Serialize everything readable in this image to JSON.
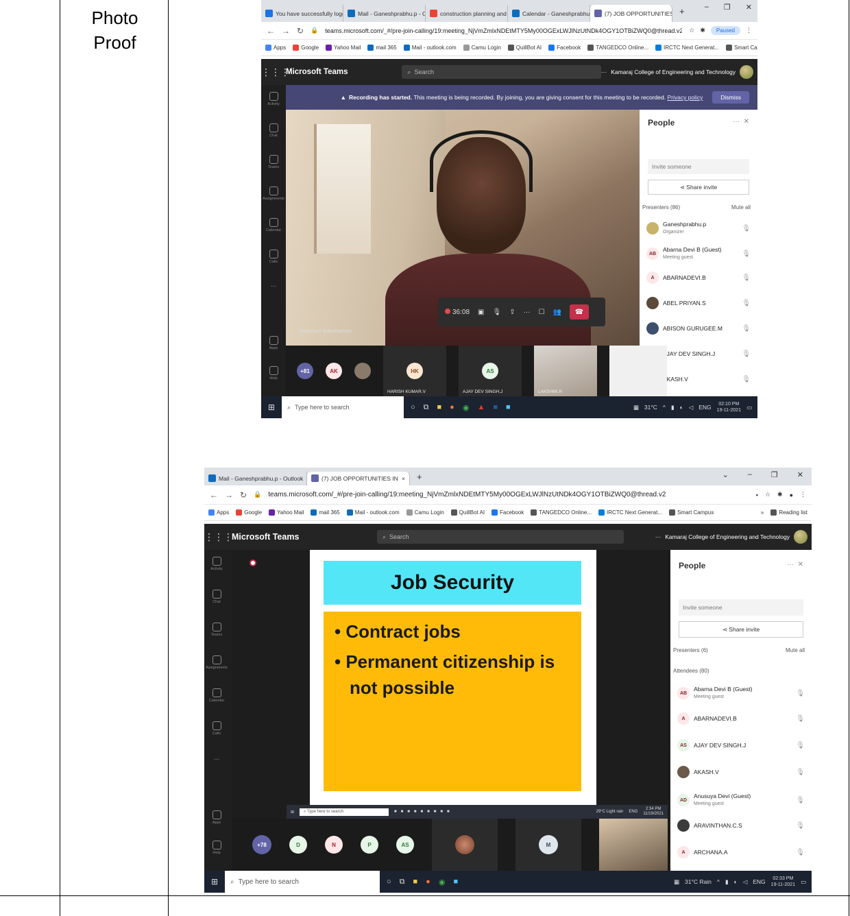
{
  "document": {
    "label_line1": "Photo",
    "label_line2": "Proof"
  },
  "shot1": {
    "tabs": [
      {
        "label": "You have successfully logged",
        "color": "#1a73e8"
      },
      {
        "label": "Mail - Ganeshprabhu.p - Out",
        "color": "#0f6cbd"
      },
      {
        "label": "construction planning and s",
        "color": "#ea4335"
      },
      {
        "label": "Calendar - Ganeshprabhu.p",
        "color": "#0f6cbd"
      },
      {
        "label": "(7) JOB OPPORTUNITIES",
        "color": "#6264a7"
      }
    ],
    "url": "teams.microsoft.com/_#/pre-join-calling/19:meeting_NjVmZmlxNDEtMTY5My00OGExLWJlNzUtNDk4OGY1OTBiZWQ0@thread.v2",
    "paused": "Paused",
    "bookmarks": [
      "Apps",
      "Google",
      "Yahoo Mail",
      "mail 365",
      "Mail - outlook.com",
      "Camu Login",
      "QuillBot AI",
      "Facebook",
      "TANGEDCO Online...",
      "IRCTC Next Generat...",
      "Smart Campus",
      "»",
      "Reading list"
    ],
    "app_title": "Microsoft Teams",
    "search_placeholder": "Search",
    "org": "Kamaraj College of Engineering and Technology",
    "rail": [
      "Activity",
      "Chat",
      "Teams",
      "Assignments",
      "Calendar",
      "Calls",
      "...",
      "Apps",
      "Help"
    ],
    "banner_bold": "Recording has started.",
    "banner_text": "This meeting is being recorded. By joining, you are giving consent for this meeting to be recorded.",
    "banner_link": "Privacy policy",
    "dismiss": "Dismiss",
    "people_title": "People",
    "invite": "Invite someone",
    "share": "Share invite",
    "presenters": "Presenters (86)",
    "mute_all": "Mute all",
    "people": [
      {
        "name": "Ganeshprabhu.p",
        "sub": "Organizer",
        "initials": "",
        "bg": "#c9b36a"
      },
      {
        "name": "Abarna Devi B (Guest)",
        "sub": "Meeting guest",
        "initials": "AB",
        "bg": "#fde7e9"
      },
      {
        "name": "ABARNADEVI.B",
        "sub": "",
        "initials": "A",
        "bg": "#fde7e9"
      },
      {
        "name": "ABEL PRIYAN.S",
        "sub": "",
        "initials": "",
        "bg": "#5b4a3a"
      },
      {
        "name": "ABISON GURUGEE.M",
        "sub": "",
        "initials": "",
        "bg": "#3d4f6b"
      },
      {
        "name": "AJAY DEV SINGH.J",
        "sub": "",
        "initials": "AS",
        "bg": "#e8f5e9"
      },
      {
        "name": "AKASH.V",
        "sub": "",
        "initials": "",
        "bg": "#6b5a4a"
      }
    ],
    "speaker": "Neelamani Subramaniam",
    "timer": "36:08",
    "gallery": {
      "more": "+81",
      "ak": "AK",
      "hk": "HK",
      "hk_name": "HARISH KUMAR.V",
      "as": "AS",
      "as_name": "AJAY DEV SINGH.J",
      "lak_name": "LAKSHMI.R"
    },
    "taskbar_search": "Type here to search",
    "weather": "31°C",
    "lang": "ENG",
    "time": "02:10 PM",
    "date": "19-11-2021"
  },
  "shot2": {
    "tabs": [
      {
        "label": "Mail - Ganeshprabhu.p - Outlook",
        "color": "#0f6cbd"
      },
      {
        "label": "(7) JOB OPPORTUNITIES IN",
        "color": "#6264a7"
      }
    ],
    "url": "teams.microsoft.com/_#/pre-join-calling/19:meeting_NjVmZmlxNDEtMTY5My00OGExLWJlNzUtNDk4OGY1OTBiZWQ0@thread.v2",
    "bookmarks": [
      "Apps",
      "Google",
      "Yahoo Mail",
      "mail 365",
      "Mail - outlook.com",
      "Camu Login",
      "QuillBot AI",
      "Facebook",
      "TANGEDCO Online...",
      "IRCTC Next Generat...",
      "Smart Campus",
      "»",
      "Reading list"
    ],
    "app_title": "Microsoft Teams",
    "search_placeholder": "Search",
    "org": "Kamaraj College of Engineering and Technology",
    "rail": [
      "Activity",
      "Chat",
      "Teams",
      "Assignments",
      "Calendar",
      "Calls",
      "...",
      "Apps",
      "Help"
    ],
    "slide_title": "Job Security",
    "bullets": [
      "Contract jobs",
      "Permanent citizenship is not possible"
    ],
    "people_title": "People",
    "invite": "Invite someone",
    "share": "Share invite",
    "presenters": "Presenters (6)",
    "mute_all": "Mute all",
    "attendees": "Attendees (80)",
    "people": [
      {
        "name": "Abarna Devi B (Guest)",
        "sub": "Meeting guest",
        "initials": "AB",
        "bg": "#fde7e9"
      },
      {
        "name": "ABARNADEVI.B",
        "sub": "",
        "initials": "A",
        "bg": "#fde7e9"
      },
      {
        "name": "AJAY DEV SINGH.J",
        "sub": "",
        "initials": "AS",
        "bg": "#e8f5e9"
      },
      {
        "name": "AKASH.V",
        "sub": "",
        "initials": "",
        "bg": "#6b5a4a"
      },
      {
        "name": "Anusuya Devi (Guest)",
        "sub": "Meeting guest",
        "initials": "AD",
        "bg": "#e8f5e9"
      },
      {
        "name": "ARAVINTHAN.C.S",
        "sub": "",
        "initials": "",
        "bg": "#3b3b3b"
      },
      {
        "name": "ARCHANA.A",
        "sub": "",
        "initials": "A",
        "bg": "#fde7e9"
      }
    ],
    "inner_taskbar_search": "Type here to search",
    "inner_weather": "29°C Light rain",
    "inner_lang": "ENG",
    "inner_time": "2:34 PM",
    "inner_date": "11/19/2021",
    "gallery": {
      "more": "+78",
      "d": "D",
      "n": "N",
      "p": "P",
      "as": "AS",
      "m": "M"
    },
    "taskbar_search": "Type here to search",
    "weather": "31°C Rain",
    "lang": "ENG",
    "time": "02:33 PM",
    "date": "19-11-2021"
  }
}
